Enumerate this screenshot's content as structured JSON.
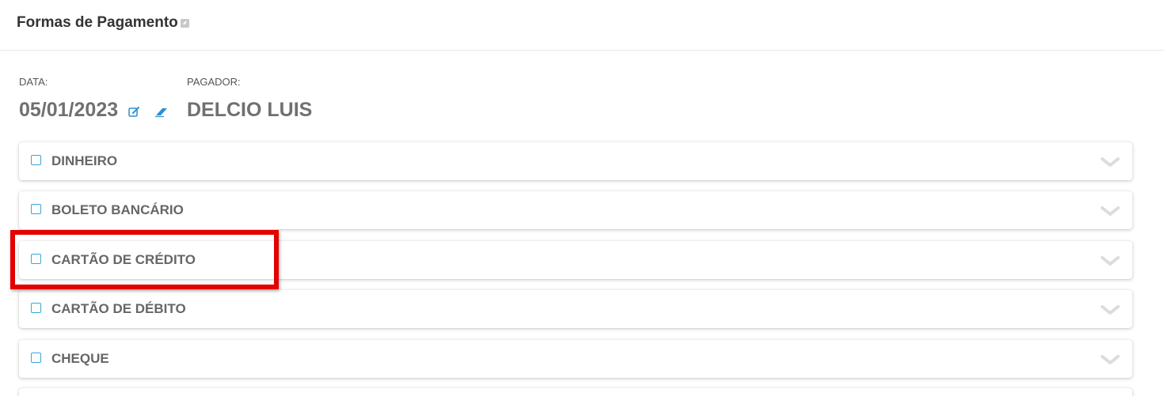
{
  "header": {
    "title": "Formas de Pagamento"
  },
  "fields": {
    "date_label": "DATA:",
    "date_value": "05/01/2023",
    "payer_label": "PAGADOR:",
    "payer_value": "DELCIO LUIS"
  },
  "payment_methods": [
    {
      "label": "DINHEIRO",
      "checked": false
    },
    {
      "label": "BOLETO BANCÁRIO",
      "checked": false
    },
    {
      "label": "CARTÃO DE CRÉDITO",
      "checked": false,
      "highlighted": true
    },
    {
      "label": "CARTÃO DE DÉBITO",
      "checked": false
    },
    {
      "label": "CHEQUE",
      "checked": false
    }
  ],
  "icons": {
    "title_icon": "external-link-icon",
    "date_edit": "edit-icon",
    "date_clear": "eraser-icon",
    "card_toggle": "chevron-down-icon"
  },
  "colors": {
    "accent": "#3aa6db",
    "highlight": "#e30000",
    "label_text": "#666666"
  }
}
